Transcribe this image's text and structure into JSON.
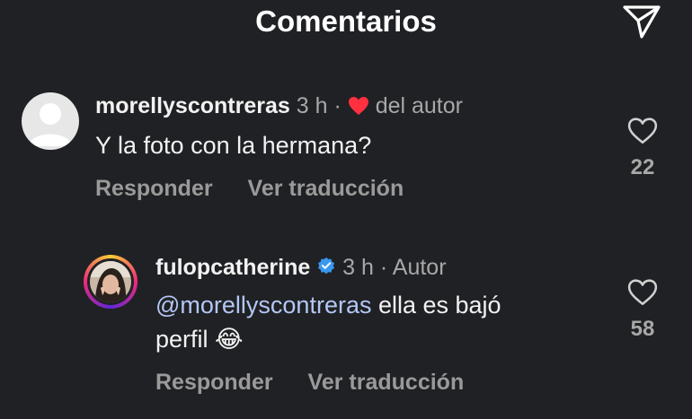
{
  "header": {
    "title": "Comentarios",
    "send_icon": "send-icon"
  },
  "comments": [
    {
      "username": "morellyscontreras",
      "time": "3 h",
      "separator": "·",
      "author_badge": "del autor",
      "author_heart_color": "#ff3040",
      "text": "Y la foto con la hermana?",
      "reply_label": "Responder",
      "translate_label": "Ver traducción",
      "likes": "22"
    },
    {
      "username": "fulopcatherine",
      "verified_color": "#3897f0",
      "time": "3 h",
      "separator": "·",
      "author_label": "Autor",
      "mention": "@morellyscontreras",
      "text_after_mention": " ella es bajó",
      "text_line2": "perfil",
      "emoji": "😂",
      "reply_label": "Responder",
      "translate_label": "Ver traducción",
      "likes": "58"
    }
  ]
}
